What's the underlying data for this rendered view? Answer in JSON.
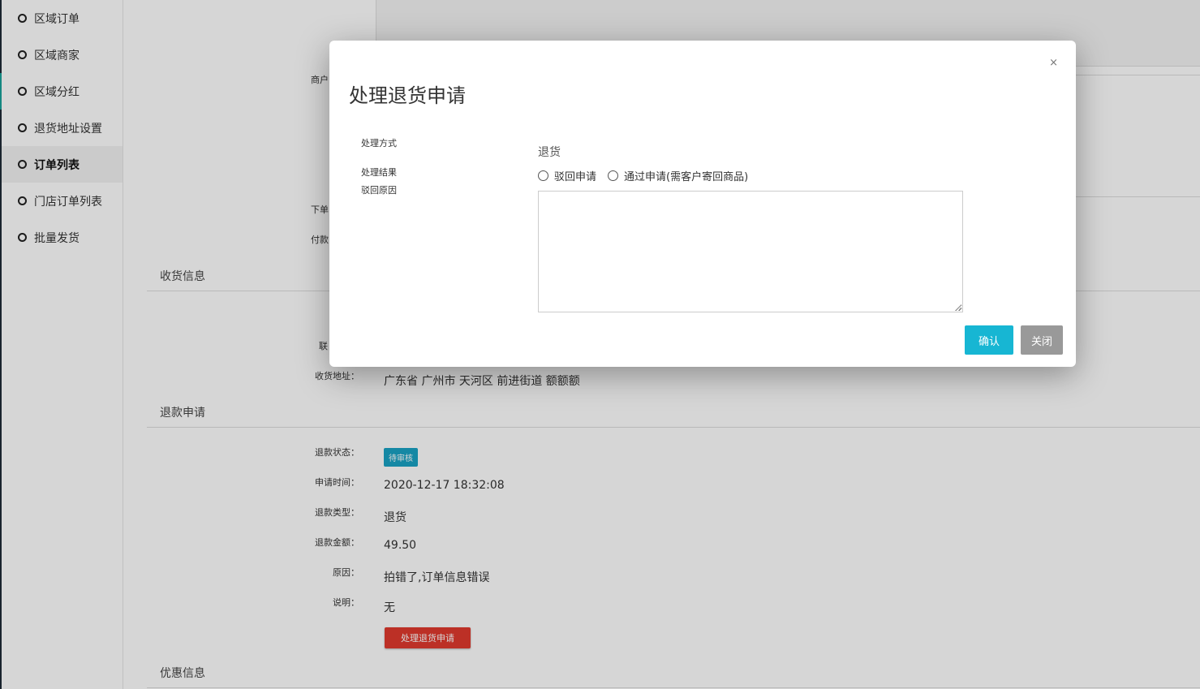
{
  "sidebar": {
    "items": [
      {
        "label": "区域订单"
      },
      {
        "label": "区域商家"
      },
      {
        "label": "区域分红"
      },
      {
        "label": "退货地址设置"
      },
      {
        "label": "订单列表"
      },
      {
        "label": "门店订单列表"
      },
      {
        "label": "批量发货"
      }
    ]
  },
  "main": {
    "fragments": {
      "merchant": "商户",
      "order_time": "下单",
      "pay": "付款",
      "contact": "联"
    },
    "shipping": {
      "title": "收货信息",
      "address_label": "收货地址：",
      "address_value": "广东省 广州市 天河区 前进街道 额额额"
    },
    "refund": {
      "title": "退款申请",
      "status_label": "退款状态：",
      "status_value": "待审核",
      "time_label": "申请时间：",
      "time_value": "2020-12-17 18:32:08",
      "type_label": "退款类型：",
      "type_value": "退货",
      "amount_label": "退款金额：",
      "amount_value": "49.50",
      "reason_label": "原因：",
      "reason_value": "拍错了,订单信息错误",
      "note_label": "说明：",
      "note_value": "无",
      "process_button": "处理退货申请"
    },
    "discount": {
      "title": "优惠信息"
    }
  },
  "modal": {
    "close": "×",
    "title": "处理退货申请",
    "method_label": "处理方式",
    "method_value": "退货",
    "result_label": "处理结果",
    "reason_label": "驳回原因",
    "option_reject": "驳回申请",
    "option_approve": "通过申请(需客户寄回商品)",
    "confirm": "确认",
    "cancel": "关闭"
  }
}
